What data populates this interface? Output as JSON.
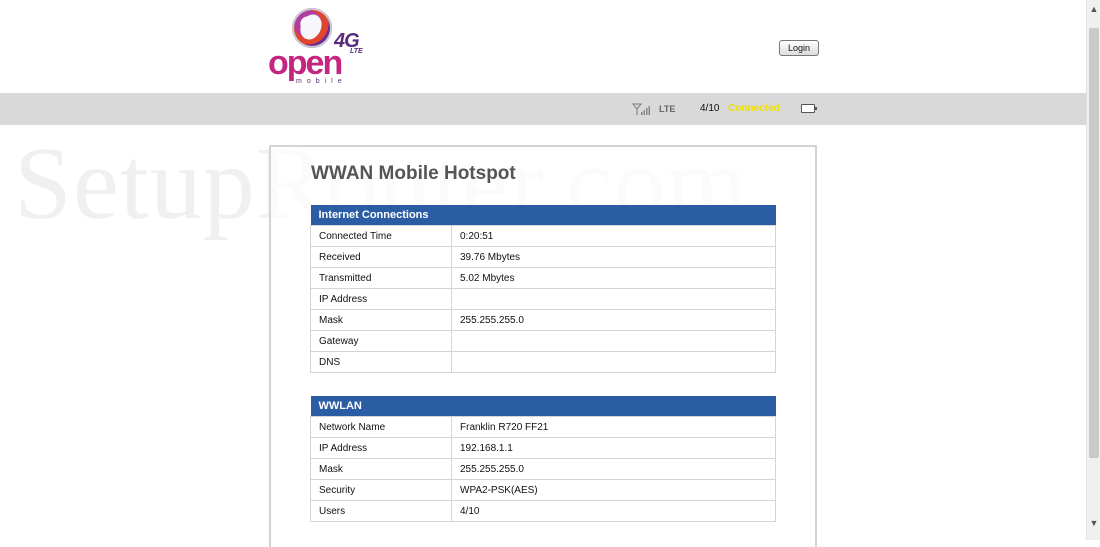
{
  "header": {
    "logo": {
      "badge": "4G",
      "badge_sub": "LTE",
      "brand": "open",
      "brand_sub": "mobile"
    },
    "login_label": "Login"
  },
  "status": {
    "network_type": "LTE",
    "users": "4/10",
    "connection": "Connected"
  },
  "watermark": "SetupRouter.com",
  "page_title": "WWAN Mobile Hotspot",
  "internet": {
    "heading": "Internet Connections",
    "rows": [
      {
        "label": "Connected Time",
        "value": "0:20:51"
      },
      {
        "label": "Received",
        "value": "39.76 Mbytes"
      },
      {
        "label": "Transmitted",
        "value": "5.02 Mbytes"
      },
      {
        "label": "IP Address",
        "value": ""
      },
      {
        "label": "Mask",
        "value": "255.255.255.0"
      },
      {
        "label": "Gateway",
        "value": ""
      },
      {
        "label": "DNS",
        "value": ""
      }
    ]
  },
  "wwlan": {
    "heading": "WWLAN",
    "rows": [
      {
        "label": "Network Name",
        "value": "Franklin R720 FF21"
      },
      {
        "label": "IP Address",
        "value": "192.168.1.1"
      },
      {
        "label": "Mask",
        "value": "255.255.255.0"
      },
      {
        "label": "Security",
        "value": "WPA2-PSK(AES)"
      },
      {
        "label": "Users",
        "value": "4/10"
      }
    ]
  },
  "icons": {
    "signal": "signal-strength-icon",
    "battery": "battery-icon",
    "scroll_up": "chevron-up-icon",
    "scroll_down": "chevron-down-icon"
  },
  "colors": {
    "section_header": "#2b5da4",
    "status_bar": "#d9d9d9",
    "connected_text": "#f0e000",
    "brand_pink": "#c42580",
    "brand_purple": "#5a2c7a"
  }
}
